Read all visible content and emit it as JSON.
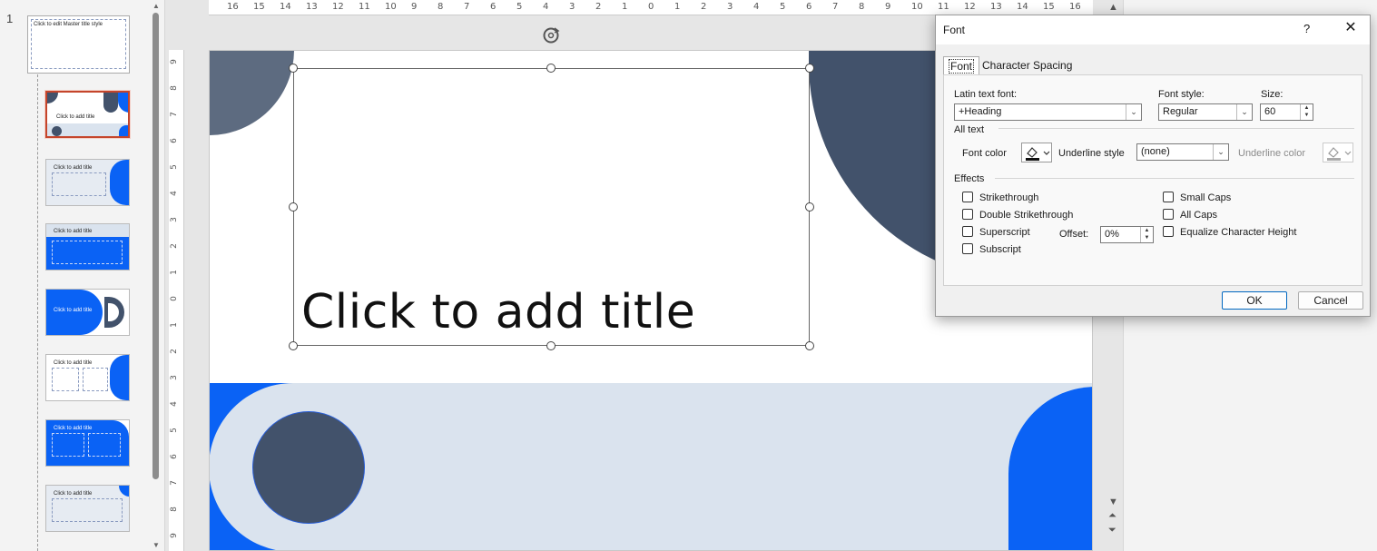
{
  "thumbnails": {
    "slide_number": "1",
    "master_title": "Click to edit Master title style",
    "layouts": [
      {
        "title": "Click to add title"
      },
      {
        "title": "Click to add title"
      },
      {
        "title": "Click to add title"
      },
      {
        "title": "Click to add title"
      },
      {
        "title": "Click to add title"
      },
      {
        "title": "Click to add title"
      },
      {
        "title": "Click to add title"
      }
    ]
  },
  "ruler": {
    "horizontal_ticks": [
      "16",
      "15",
      "14",
      "13",
      "12",
      "11",
      "10",
      "9",
      "8",
      "7",
      "6",
      "5",
      "4",
      "3",
      "2",
      "1",
      "0",
      "1",
      "2",
      "3",
      "4",
      "5",
      "6",
      "7",
      "8",
      "9",
      "10",
      "11",
      "12",
      "13",
      "14",
      "15",
      "16"
    ],
    "vertical_ticks": [
      "9",
      "8",
      "7",
      "6",
      "5",
      "4",
      "3",
      "2",
      "1",
      "0",
      "1",
      "2",
      "3",
      "4",
      "5",
      "6",
      "7",
      "8",
      "9"
    ]
  },
  "slide": {
    "title_placeholder": "Click to add title",
    "colors": {
      "slate": "#42526b",
      "slate_light": "#5d6b80",
      "blue": "#0a62f5",
      "pale": "#dae3ee"
    }
  },
  "font_dialog": {
    "title": "Font",
    "help": "?",
    "close": "✕",
    "tabs": [
      "Font",
      "Character Spacing"
    ],
    "latin_font_label": "Latin text font:",
    "latin_font_value": "+Heading",
    "font_style_label": "Font style:",
    "font_style_value": "Regular",
    "size_label": "Size:",
    "size_value": "60",
    "all_text_label": "All text",
    "font_color_label": "Font color",
    "underline_style_label": "Underline style",
    "underline_style_value": "(none)",
    "underline_color_label": "Underline color",
    "effects_label": "Effects",
    "effects_left": [
      "Strikethrough",
      "Double Strikethrough",
      "Superscript",
      "Subscript"
    ],
    "effects_right": [
      "Small Caps",
      "All Caps",
      "Equalize Character Height"
    ],
    "offset_label": "Offset:",
    "offset_value": "0%",
    "ok_label": "OK",
    "cancel_label": "Cancel"
  }
}
